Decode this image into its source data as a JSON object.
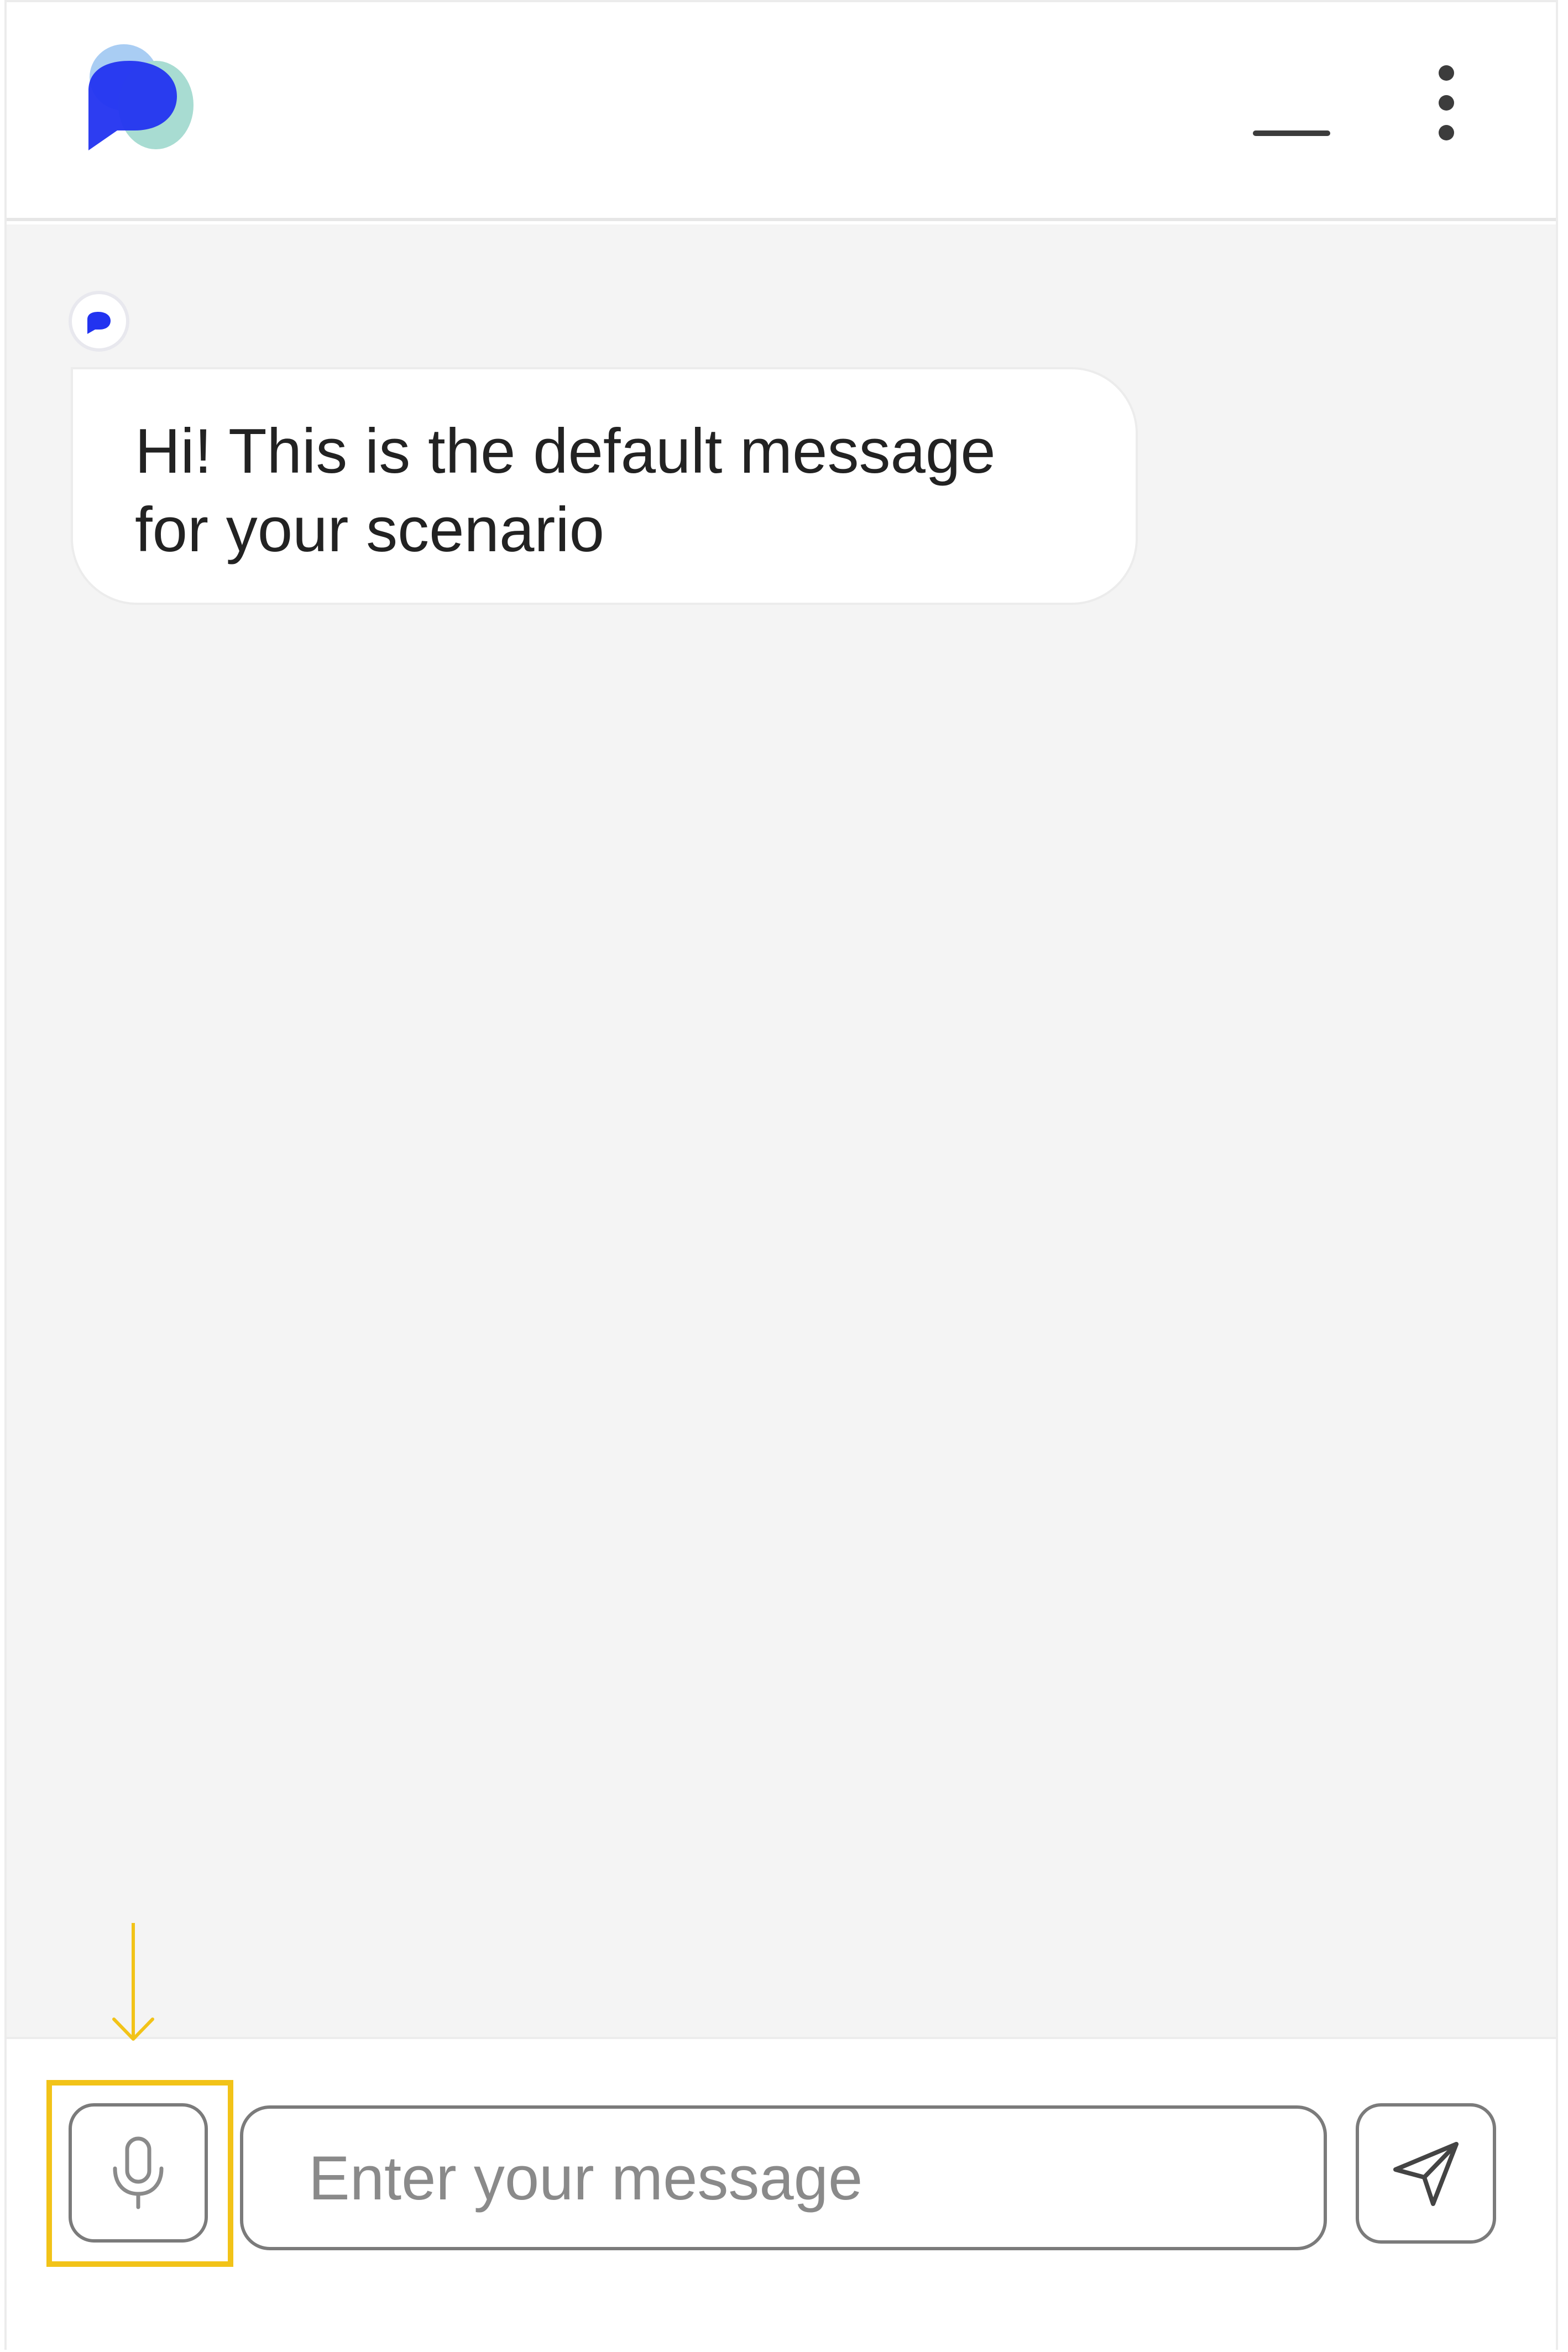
{
  "header": {
    "logo_icon": "speech-bubble-logo",
    "minimize_icon": "minimize-icon",
    "more_icon": "kebab-menu-icon"
  },
  "conversation": {
    "bot_avatar_icon": "speech-bubble-logo",
    "messages": [
      {
        "sender": "bot",
        "text": "Hi! This is the default message for your scenario"
      }
    ]
  },
  "composer": {
    "mic_icon": "microphone-icon",
    "placeholder": "Enter your message",
    "value": "",
    "send_icon": "send-icon"
  },
  "annotation": {
    "highlight_target": "microphone-button",
    "highlight_color": "#f2c318",
    "arrow_icon": "down-arrow-icon"
  },
  "colors": {
    "brand_primary": "#2233f0",
    "brand_light_blue": "#a9cdf3",
    "brand_teal": "#a8dcd2",
    "chat_background": "#f4f4f4",
    "border_gray": "#7b7b7b"
  }
}
